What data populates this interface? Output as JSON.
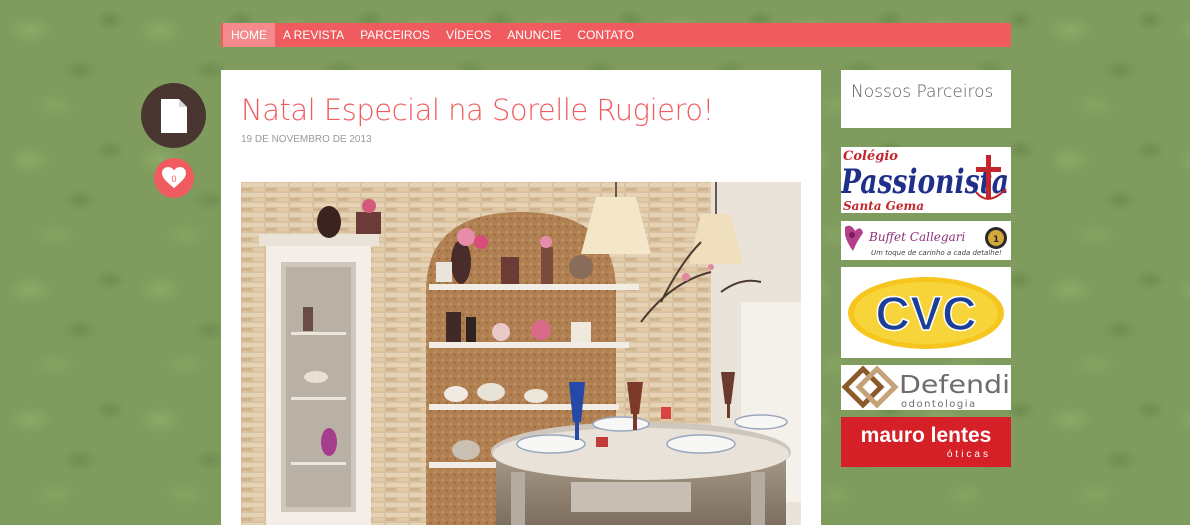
{
  "nav": {
    "items": [
      {
        "label": "HOME",
        "active": true
      },
      {
        "label": "A REVISTA"
      },
      {
        "label": "PARCEIROS"
      },
      {
        "label": "VÍDEOS"
      },
      {
        "label": "ANUNCIE"
      },
      {
        "label": "CONTATO"
      }
    ]
  },
  "post": {
    "icon": "document-icon",
    "likes": "0",
    "title": "Natal Especial na Sorelle Rugiero!",
    "date": "19 DE NOVEMBRO DE 2013"
  },
  "sidebar": {
    "title": "Nossos Parceiros",
    "ads": [
      {
        "line1": "Colégio",
        "line2": "Passionista",
        "line3": "Santa Gema"
      },
      {
        "line1": "Buffet Callegari",
        "line2": "Um toque de carinho a cada detalhe!"
      },
      {
        "line1": "CVC"
      },
      {
        "line1": "Defendi",
        "line2": "odontologia"
      },
      {
        "line1": "mauro lentes",
        "line2": "óticas"
      }
    ]
  },
  "colors": {
    "accent": "#ef5b5e",
    "icon_bg": "#4a3631",
    "background": "#7f9c5e"
  }
}
